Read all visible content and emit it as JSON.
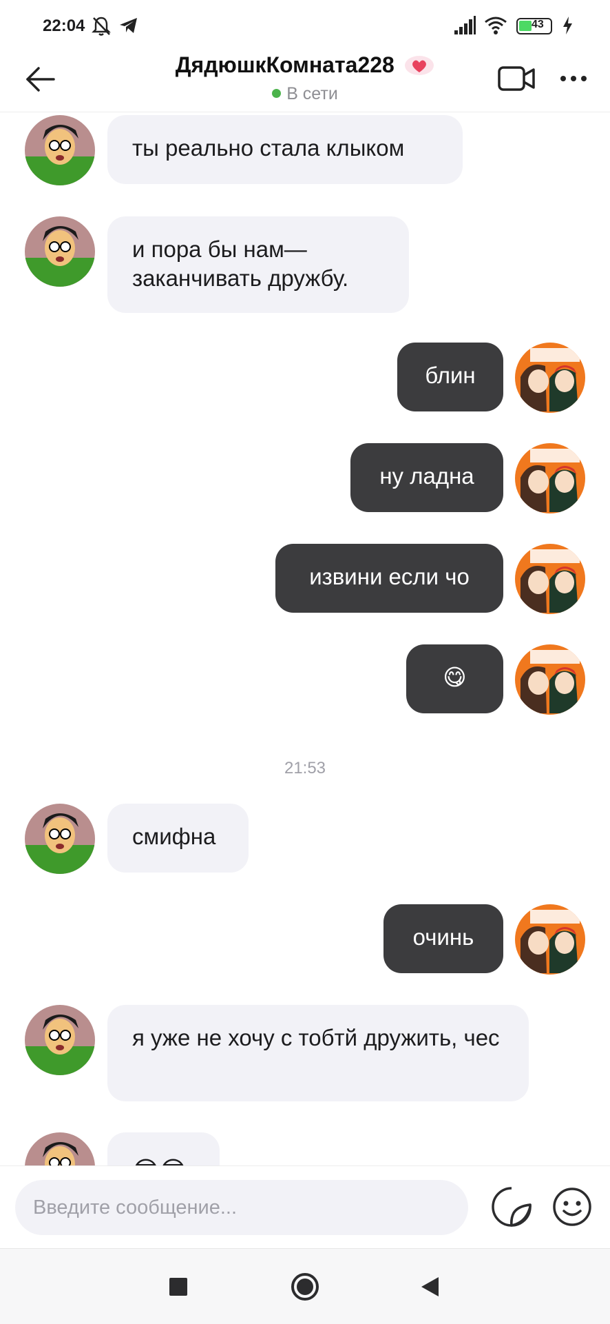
{
  "status_bar": {
    "time": "22:04",
    "battery": "43",
    "icons": [
      "muted-bell-icon",
      "telegram-icon",
      "signal-icon",
      "wifi-icon",
      "battery-icon",
      "charging-icon"
    ]
  },
  "header": {
    "title": "ДядюшкКомната228",
    "status": "В сети",
    "icons": [
      "back-arrow-icon",
      "heart-sticker-icon",
      "video-call-icon",
      "more-dots-icon"
    ]
  },
  "messages": [
    {
      "side": "in",
      "text": "ты реально стала клыком"
    },
    {
      "side": "in",
      "text": "и пора бы нам— заканчивать дружбу."
    },
    {
      "side": "out",
      "text": "блин"
    },
    {
      "side": "out",
      "text": "ну ладна"
    },
    {
      "side": "out",
      "text": "извини если чо"
    },
    {
      "side": "out",
      "text": "😋"
    },
    {
      "type": "time",
      "text": "21:53"
    },
    {
      "side": "in",
      "text": "смифна"
    },
    {
      "side": "out",
      "text": "очинь"
    },
    {
      "side": "in",
      "text": "я уже не хочу с тобтй дружить, чес"
    },
    {
      "side": "in",
      "text": "😎😎"
    }
  ],
  "composer": {
    "placeholder": "Введите сообщение...",
    "icons": [
      "sticker-icon",
      "emoji-icon"
    ]
  },
  "navbar": {
    "icons": [
      "recents-square-icon",
      "home-circle-icon",
      "back-triangle-icon"
    ]
  },
  "colors": {
    "incoming_bubble": "#f2f2f7",
    "outgoing_bubble": "#3c3c3e",
    "online": "#4bb34b",
    "battery_fill": "#4cd964"
  }
}
